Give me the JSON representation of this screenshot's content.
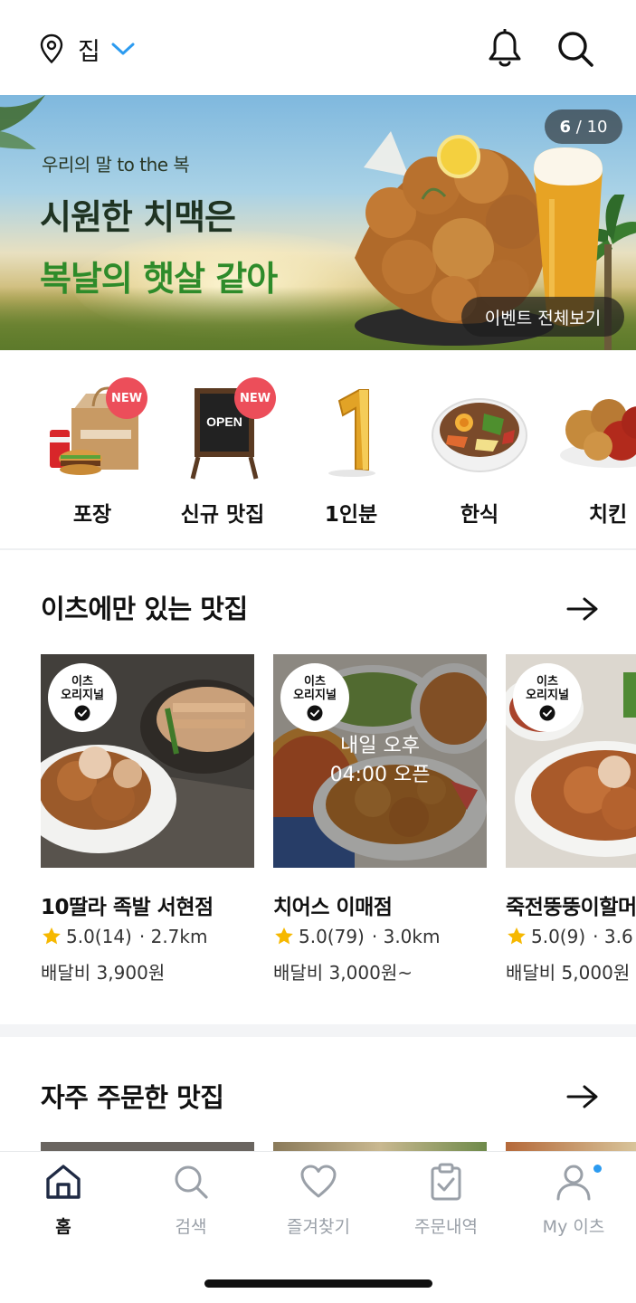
{
  "header": {
    "location_label": "집",
    "icons": [
      "location-pin-icon",
      "chevron-down-icon",
      "bell-icon",
      "search-icon"
    ],
    "accent_color": "#2c9bf0"
  },
  "banner": {
    "subtitle": "우리의 말 to the 복",
    "headline_line1": "시원한 치맥은",
    "headline_line2": "복날의 햇살 같아",
    "counter_current": "6",
    "counter_sep": " / ",
    "counter_total": "10",
    "event_button": "이벤트 전체보기",
    "headline_green": "#2e8b2a"
  },
  "categories": [
    {
      "label": "포장",
      "badge": "NEW"
    },
    {
      "label": "신규 맛집",
      "badge": "NEW",
      "sign_text": "OPEN"
    },
    {
      "label": "1인분",
      "badge": ""
    },
    {
      "label": "한식",
      "badge": ""
    },
    {
      "label": "치킨",
      "badge": ""
    }
  ],
  "section_exclusive": {
    "title": "이츠에만 있는 맛집",
    "badge_line1": "이츠",
    "badge_line2": "오리지널",
    "items": [
      {
        "name": "10딸라 족발 서현점",
        "rating": "5.0(14)",
        "distance": "· 2.7km",
        "fee": "배달비 3,900원",
        "overlay": ""
      },
      {
        "name": "치어스 이매점",
        "rating": "5.0(79)",
        "distance": "· 3.0km",
        "fee": "배달비 3,000원~",
        "overlay_line1": "내일 오후",
        "overlay_line2": "04:00 오픈"
      },
      {
        "name": "죽전뚱뚱이할머",
        "rating": "5.0(9)",
        "distance": "· 3.6",
        "fee": "배달비 5,000원",
        "overlay": ""
      }
    ]
  },
  "section_frequent": {
    "title": "자주 주문한 맛집"
  },
  "bottom_nav": [
    {
      "label": "홈",
      "icon": "home-icon",
      "active": true
    },
    {
      "label": "검색",
      "icon": "search-icon",
      "active": false
    },
    {
      "label": "즐겨찾기",
      "icon": "heart-icon",
      "active": false
    },
    {
      "label": "주문내역",
      "icon": "clipboard-check-icon",
      "active": false
    },
    {
      "label": "My 이츠",
      "icon": "user-icon",
      "active": false
    }
  ]
}
